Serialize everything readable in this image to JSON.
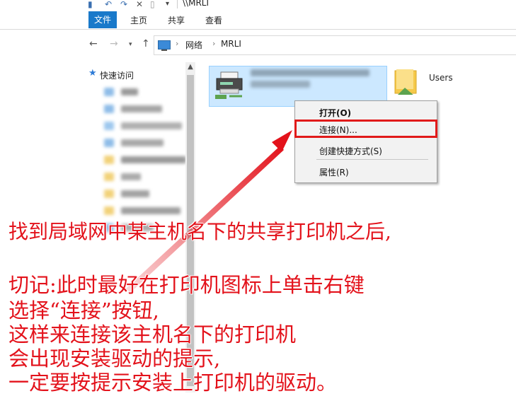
{
  "window": {
    "title": "\\\\MRLI"
  },
  "ribbon": {
    "tabs": [
      "文件",
      "主页",
      "共享",
      "查看"
    ]
  },
  "address": {
    "crumbs": [
      "网络",
      "MRLI"
    ]
  },
  "navpane": {
    "quick_access": "快速访问"
  },
  "content": {
    "folder_label": "Users"
  },
  "context_menu": {
    "items": [
      "打开(O)",
      "连接(N)...",
      "创建快捷方式(S)",
      "属性(R)"
    ]
  },
  "annotation": {
    "line1": "找到局域网中某主机名下的共享打印机之后,",
    "line2": "切记:此时最好在打印机图标上单击右键",
    "line3": "选择“连接”按钮,",
    "line4": "这样来连接该主机名下的打印机",
    "line5": "会出现安装驱动的提示,",
    "line6": "一定要按提示安装上打印机的驱动。"
  },
  "colors": {
    "accent": "#1979ca",
    "annotation_red": "#e3121b",
    "selection": "#cce8ff"
  }
}
